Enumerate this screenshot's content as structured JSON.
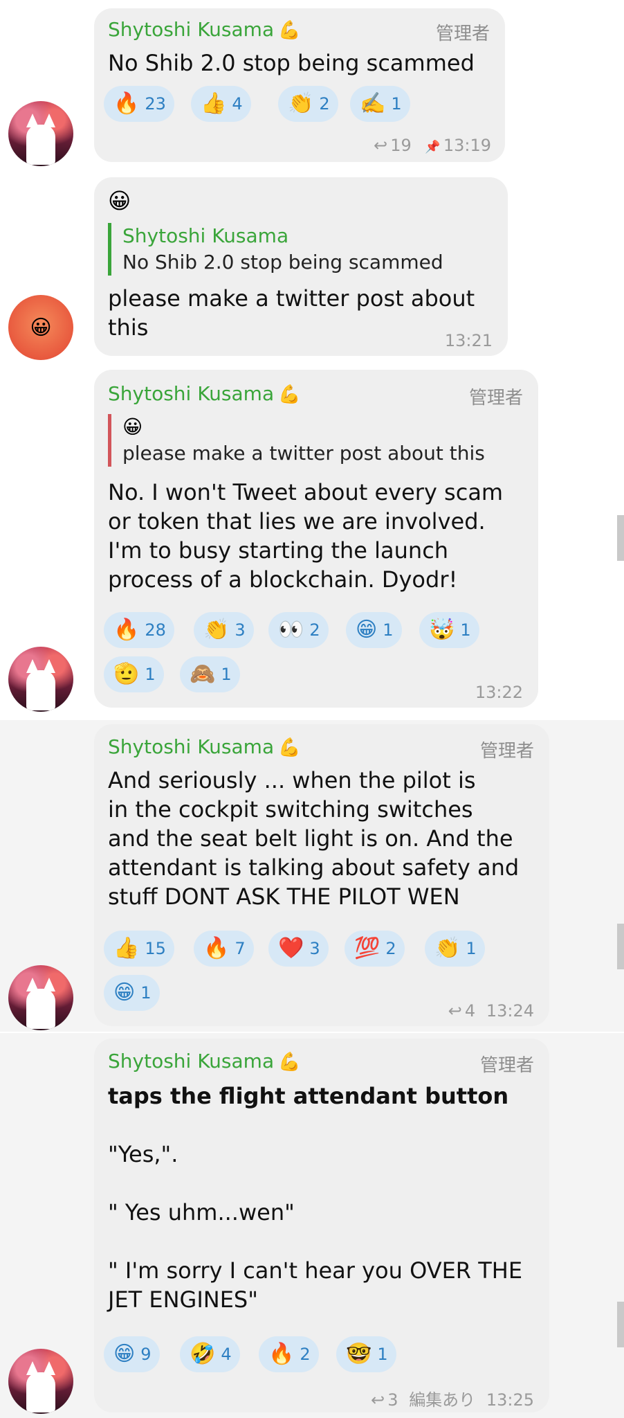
{
  "messages": [
    {
      "sender": "Shytoshi Kusama",
      "sender_badge": "💪",
      "role": "管理者",
      "text": "No Shib 2.0 stop being scammed",
      "reactions": [
        {
          "emoji": "🔥",
          "count": "23"
        },
        {
          "emoji": "👍",
          "count": "4"
        },
        {
          "emoji": "👏",
          "count": "2"
        },
        {
          "emoji": "✍️",
          "count": "1"
        }
      ],
      "replies": "19",
      "pinned_icon": "📌",
      "time": "13:19"
    },
    {
      "sender_emoji": "😀",
      "quote_name": "Shytoshi Kusama",
      "quote_text": "No Shib 2.0 stop being scammed",
      "text": "please make a twitter post about\nthis",
      "time": "13:21"
    },
    {
      "sender": "Shytoshi Kusama",
      "sender_badge": "💪",
      "role": "管理者",
      "quote_emoji": "😀",
      "quote_text": "please make a twitter post about this",
      "text": "No. I won't Tweet about every scam\nor token that lies we are involved.\nI'm to busy starting the launch\nprocess of a blockchain. Dyodr!",
      "reactions": [
        {
          "emoji": "🔥",
          "count": "28"
        },
        {
          "emoji": "👏",
          "count": "3"
        },
        {
          "emoji": "👀",
          "count": "2"
        },
        {
          "emoji": "😁",
          "count": "1"
        },
        {
          "emoji": "🤯",
          "count": "1"
        },
        {
          "emoji": "🫡",
          "count": "1"
        },
        {
          "emoji": "🙈",
          "count": "1"
        }
      ],
      "time": "13:22"
    },
    {
      "sender": "Shytoshi Kusama",
      "sender_badge": "💪",
      "role": "管理者",
      "text": "And seriously ... when the pilot is\nin the cockpit switching switches\nand the seat belt light is on. And the\nattendant is talking about safety and\nstuff DONT ASK THE PILOT WEN",
      "reactions": [
        {
          "emoji": "👍",
          "count": "15"
        },
        {
          "emoji": "🔥",
          "count": "7"
        },
        {
          "emoji": "❤️",
          "count": "3"
        },
        {
          "emoji": "💯",
          "count": "2"
        },
        {
          "emoji": "👏",
          "count": "1"
        },
        {
          "emoji": "😁",
          "count": "1"
        }
      ],
      "replies": "4",
      "time": "13:24"
    },
    {
      "sender": "Shytoshi Kusama",
      "sender_badge": "💪",
      "role": "管理者",
      "text_bold": "taps the flight attendant button",
      "text": "\"Yes,\".\n\n\" Yes uhm...wen\"\n\n\" I'm sorry I can't hear you OVER THE\nJET ENGINES\"",
      "reactions": [
        {
          "emoji": "😁",
          "count": "9"
        },
        {
          "emoji": "🤣",
          "count": "4"
        },
        {
          "emoji": "🔥",
          "count": "2"
        },
        {
          "emoji": "🤓",
          "count": "1"
        }
      ],
      "replies": "3",
      "edited": "編集あり",
      "time": "13:25"
    }
  ],
  "icons": {
    "reply": "↩",
    "pin": "📌"
  },
  "colors": {
    "sender_green": "#3aa53a",
    "bubble_gray": "#efefef",
    "chip_blue": "#d7e8f6",
    "chip_text": "#2d7fc2",
    "highlight_band": "#f4f4f4"
  }
}
